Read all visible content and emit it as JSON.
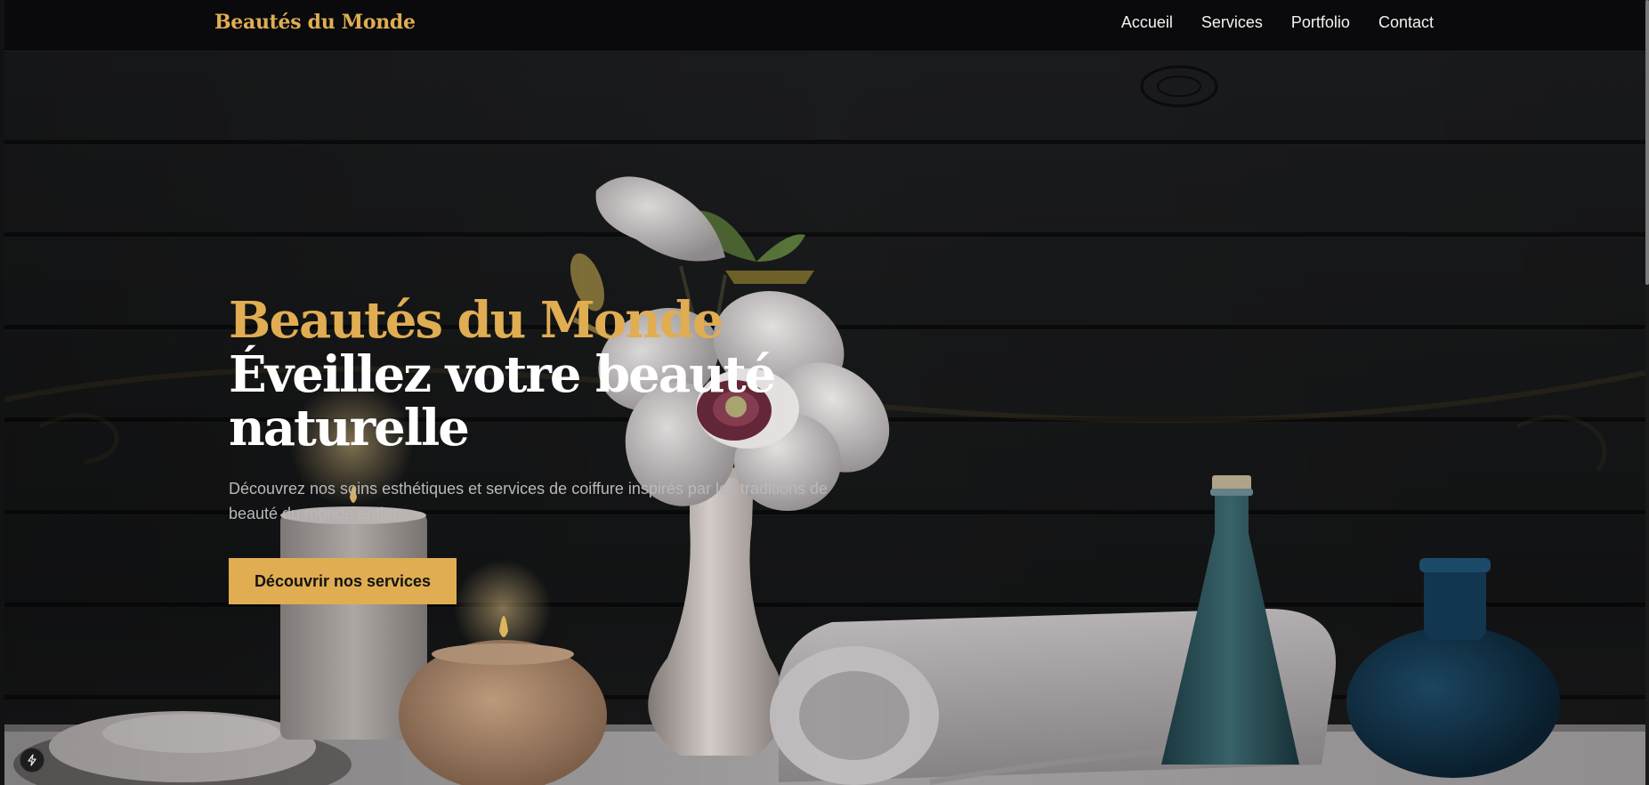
{
  "header": {
    "logo": "Beautés du Monde",
    "nav": [
      {
        "label": "Accueil"
      },
      {
        "label": "Services"
      },
      {
        "label": "Portfolio"
      },
      {
        "label": "Contact"
      }
    ]
  },
  "hero": {
    "brand": "Beautés du Monde",
    "title": "Éveillez votre beauté naturelle",
    "description": "Découvrez nos soins esthétiques et services de coiffure inspirés par les traditions de beauté du monde entier.",
    "cta_label": "Découvrir nos services",
    "background_image": "spa-still-life"
  },
  "theme": {
    "accent": "#e0ad52",
    "background": "#0a0a0c",
    "text": "#ffffff",
    "muted_text": "#b9b9b9"
  },
  "icons": {
    "dev_badge": "lightning-icon"
  }
}
